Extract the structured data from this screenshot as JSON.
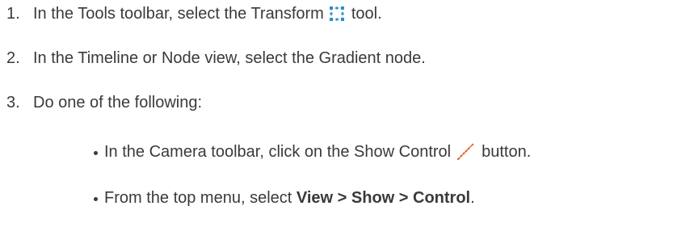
{
  "steps": [
    {
      "number": "1.",
      "text_before": "In the Tools toolbar, select the Transform",
      "icon": "transform-tool-icon",
      "text_after": "tool."
    },
    {
      "number": "2.",
      "text": "In the Timeline or Node view, select the Gradient node."
    },
    {
      "number": "3.",
      "text": "Do one of the following:"
    }
  ],
  "bullets": [
    {
      "text_before": "In the Camera toolbar, click on the Show Control",
      "icon": "show-control-icon",
      "text_after": "button."
    },
    {
      "text_before": "From the top menu, select ",
      "bold_text": "View > Show > Control",
      "text_after": "."
    }
  ],
  "colors": {
    "text": "#3a3a3a",
    "transform_icon_frame": "#c9d3e0",
    "transform_icon_handles": "#2a8fd0",
    "control_icon": "#e36b2c"
  }
}
